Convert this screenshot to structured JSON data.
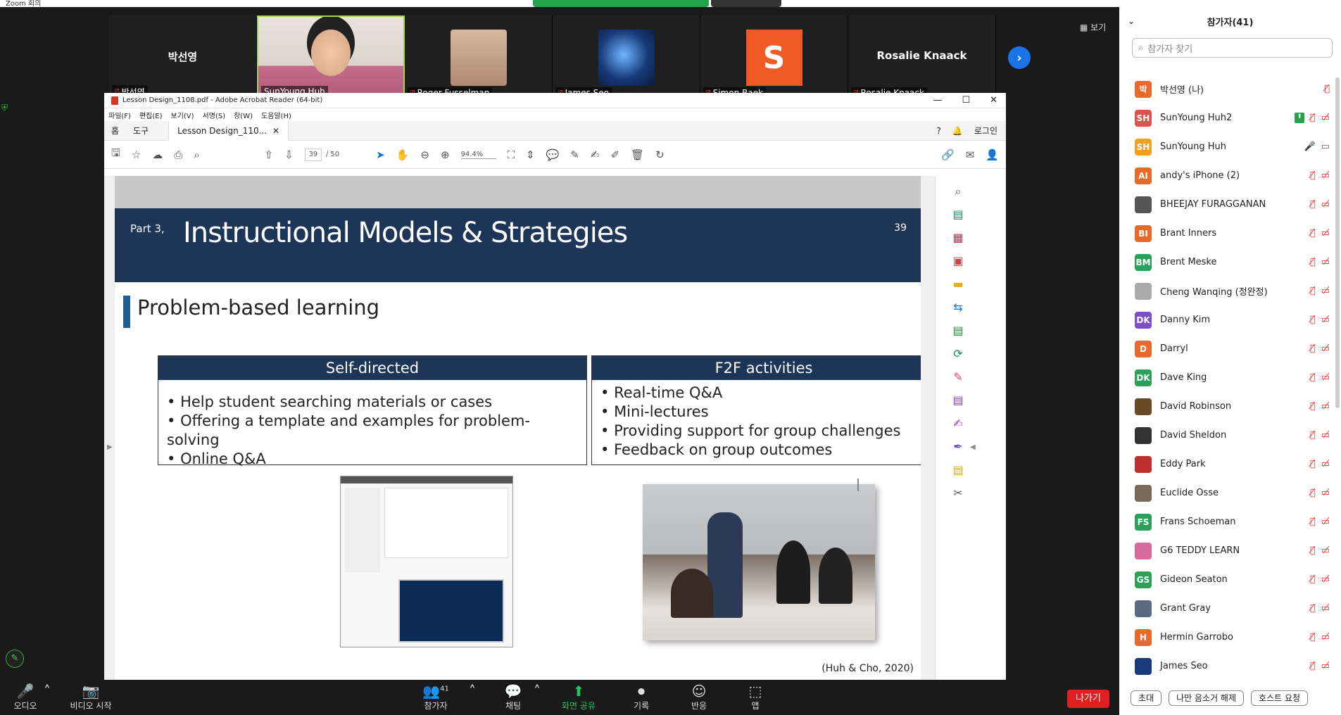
{
  "meeting": {
    "window_title": "Zoom 회의",
    "view_label": "보기",
    "next_arrow": "›"
  },
  "gallery": [
    {
      "big": "박선영",
      "name": "박선영",
      "kind": "text",
      "muted": true
    },
    {
      "big": "",
      "name": "SunYoung Huh",
      "kind": "host",
      "muted": false
    },
    {
      "big": "",
      "name": "Roger Fusselman",
      "kind": "person",
      "muted": true
    },
    {
      "big": "",
      "name": "James Seo",
      "kind": "swirl",
      "muted": true
    },
    {
      "big": "S",
      "name": "Simon Baek",
      "kind": "sletter",
      "muted": true
    },
    {
      "big": "Rosalie Knaack",
      "name": "Rosalie Knaack",
      "kind": "text",
      "muted": true
    }
  ],
  "acrobat": {
    "title": "Lesson Design_1108.pdf - Adobe Acrobat Reader (64-bit)",
    "menu": [
      "파일(F)",
      "편집(E)",
      "보기(V)",
      "서명(S)",
      "창(W)",
      "도움말(H)"
    ],
    "tabs": {
      "home": "홈",
      "tools": "도구",
      "doc": "Lesson Design_110...",
      "login": "로그인"
    },
    "page_current": "39",
    "page_total": "/  50",
    "zoom": "94.4%"
  },
  "slide": {
    "part": "Part 3,",
    "title": "Instructional Models & Strategies",
    "number": "39",
    "section": "Problem-based learning",
    "left_header": "Self-directed",
    "left_items": [
      "Help student searching materials or cases",
      "Offering a template and examples for problem-solving",
      "Online Q&A"
    ],
    "right_header": "F2F activities",
    "right_items": [
      "Real-time Q&A",
      "Mini-lectures",
      "Providing support for group challenges",
      "Feedback on group outcomes"
    ],
    "citation": "(Huh & Cho, 2020)"
  },
  "bottom_bar": {
    "audio": "오디오",
    "video": "비디오 시작",
    "participants": "참가자",
    "participants_count": "41",
    "chat": "채팅",
    "share": "화면 공유",
    "record": "기록",
    "reactions": "반응",
    "apps": "앱",
    "leave": "나가기"
  },
  "panel": {
    "title": "참가자(41)",
    "search_placeholder": "참가자 찾기",
    "participants": [
      {
        "initials": "박",
        "color": "#e8692a",
        "name": "박선영 (나)"
      },
      {
        "initials": "SH",
        "color": "#d9534f",
        "name": "SunYoung Huh2"
      },
      {
        "initials": "SH",
        "color": "#f0a020",
        "name": "SunYoung Huh"
      },
      {
        "initials": "AI",
        "color": "#e8692a",
        "name": "andy's iPhone (2)"
      },
      {
        "initials": "",
        "color": "#555555",
        "name": "BHEEJAY FURAGGANAN"
      },
      {
        "initials": "BI",
        "color": "#e8692a",
        "name": "Brant Inners"
      },
      {
        "initials": "BM",
        "color": "#2ca05a",
        "name": "Brent Meske"
      },
      {
        "initials": "",
        "color": "#aaaaaa",
        "name": "Cheng Wanqing (정완정)"
      },
      {
        "initials": "DK",
        "color": "#7a4fc9",
        "name": "Danny Kim"
      },
      {
        "initials": "D",
        "color": "#e8692a",
        "name": "Darryl"
      },
      {
        "initials": "DK",
        "color": "#2ca05a",
        "name": "Dave King"
      },
      {
        "initials": "",
        "color": "#6b4a2a",
        "name": "David Robinson"
      },
      {
        "initials": "",
        "color": "#333333",
        "name": "David Sheldon"
      },
      {
        "initials": "",
        "color": "#c03030",
        "name": "Eddy Park"
      },
      {
        "initials": "",
        "color": "#7a6a5a",
        "name": "Euclide Osse"
      },
      {
        "initials": "FS",
        "color": "#2ca05a",
        "name": "Frans Schoeman"
      },
      {
        "initials": "",
        "color": "#d86aa0",
        "name": "G6 TEDDY LEARN"
      },
      {
        "initials": "GS",
        "color": "#2ca05a",
        "name": "Gideon Seaton"
      },
      {
        "initials": "",
        "color": "#5a6a80",
        "name": "Grant Gray"
      },
      {
        "initials": "H",
        "color": "#e8692a",
        "name": "Hermin Garrobo"
      },
      {
        "initials": "",
        "color": "#1a3a7a",
        "name": "James Seo"
      }
    ],
    "footer": {
      "invite": "초대",
      "unmute_me": "나만 음소거 해제",
      "host_request": "호스트 요청"
    }
  }
}
